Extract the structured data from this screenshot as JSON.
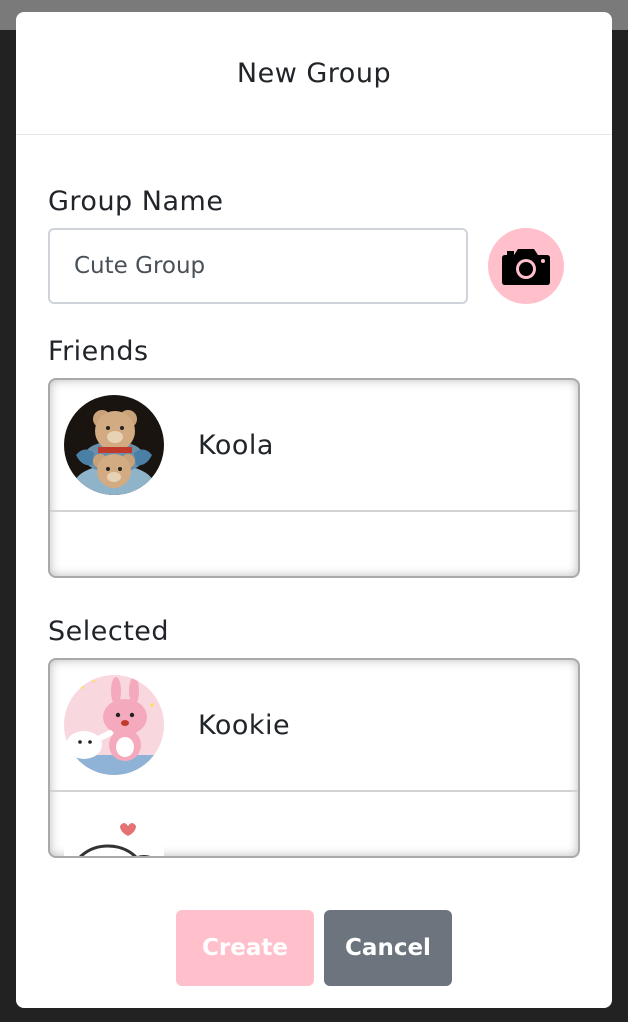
{
  "modal": {
    "title": "New Group"
  },
  "group_name": {
    "label": "Group Name",
    "value": "Cute Group"
  },
  "camera_button": {
    "icon": "camera-icon",
    "color": "#ffc0cb"
  },
  "friends": {
    "label": "Friends",
    "items": [
      {
        "name": "Koola",
        "avatar": "teddy-bears-avatar"
      }
    ]
  },
  "selected": {
    "label": "Selected",
    "items": [
      {
        "name": "Kookie",
        "avatar": "pink-bunny-avatar"
      },
      {
        "name": "",
        "avatar": "white-seal-avatar"
      }
    ]
  },
  "footer": {
    "create_label": "Create",
    "cancel_label": "Cancel"
  },
  "colors": {
    "accent_pink": "#ffc0cb",
    "cancel_gray": "#6c757d"
  }
}
